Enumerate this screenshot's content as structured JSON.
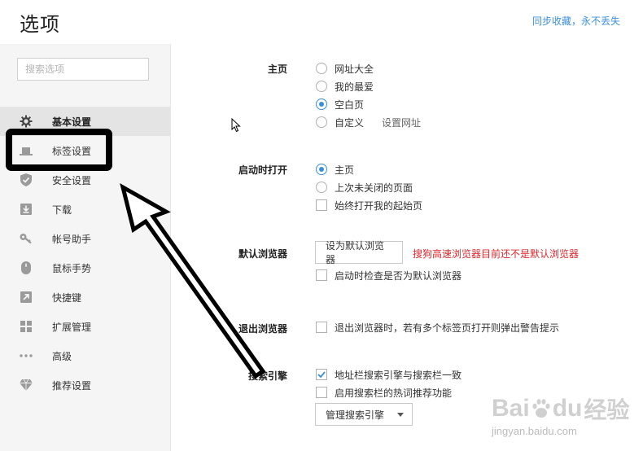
{
  "header": {
    "title": "选项",
    "sync_link": "同步收藏，永不丢失"
  },
  "sidebar": {
    "search_placeholder": "搜索选项",
    "items": [
      {
        "label": "基本设置",
        "icon": "gear-icon",
        "active": true
      },
      {
        "label": "标签设置",
        "icon": "tab-icon",
        "active": false
      },
      {
        "label": "安全设置",
        "icon": "shield-icon",
        "active": false
      },
      {
        "label": "下载",
        "icon": "download-icon",
        "active": false
      },
      {
        "label": "帐号助手",
        "icon": "key-icon",
        "active": false
      },
      {
        "label": "鼠标手势",
        "icon": "mouse-icon",
        "active": false
      },
      {
        "label": "快捷键",
        "icon": "shortcut-arrow-icon",
        "active": false
      },
      {
        "label": "扩展管理",
        "icon": "extensions-grid-icon",
        "active": false
      },
      {
        "label": "高级",
        "icon": "more-dots-icon",
        "active": false
      },
      {
        "label": "推荐设置",
        "icon": "diamond-icon",
        "active": false
      }
    ]
  },
  "main": {
    "homepage": {
      "label": "主页",
      "options": [
        "网址大全",
        "我的最爱",
        "空白页",
        "自定义"
      ],
      "selected": "空白页",
      "set_url_link": "设置网址"
    },
    "startup": {
      "label": "启动时打开",
      "options": [
        "主页",
        "上次未关闭的页面"
      ],
      "selected": "主页",
      "checkbox_label": "始终打开我的起始页",
      "checkbox_checked": false
    },
    "default_browser": {
      "label": "默认浏览器",
      "button": "设为默认浏览器",
      "warning": "搜狗高速浏览器目前还不是默认浏览器",
      "checkbox_label": "启动时检查是否为默认浏览器",
      "checkbox_checked": false
    },
    "exit_browser": {
      "label": "退出浏览器",
      "checkbox_label": "退出浏览器时，若有多个标签页打开则弹出警告提示",
      "checkbox_checked": false
    },
    "search_engine": {
      "label": "搜索引擎",
      "checkbox1_label": "地址栏搜索引擎与搜索栏一致",
      "checkbox1_checked": true,
      "checkbox2_label": "启用搜索栏的热词推荐功能",
      "checkbox2_checked": false,
      "manage_button": "管理搜索引擎"
    }
  },
  "watermark": {
    "brand": "Bai",
    "brand2": "du",
    "cn": "经验",
    "url": "jingyan.baidu.com"
  },
  "colors": {
    "accent": "#3b8fd9",
    "warning": "#e0272c",
    "annotation": "#000000"
  }
}
